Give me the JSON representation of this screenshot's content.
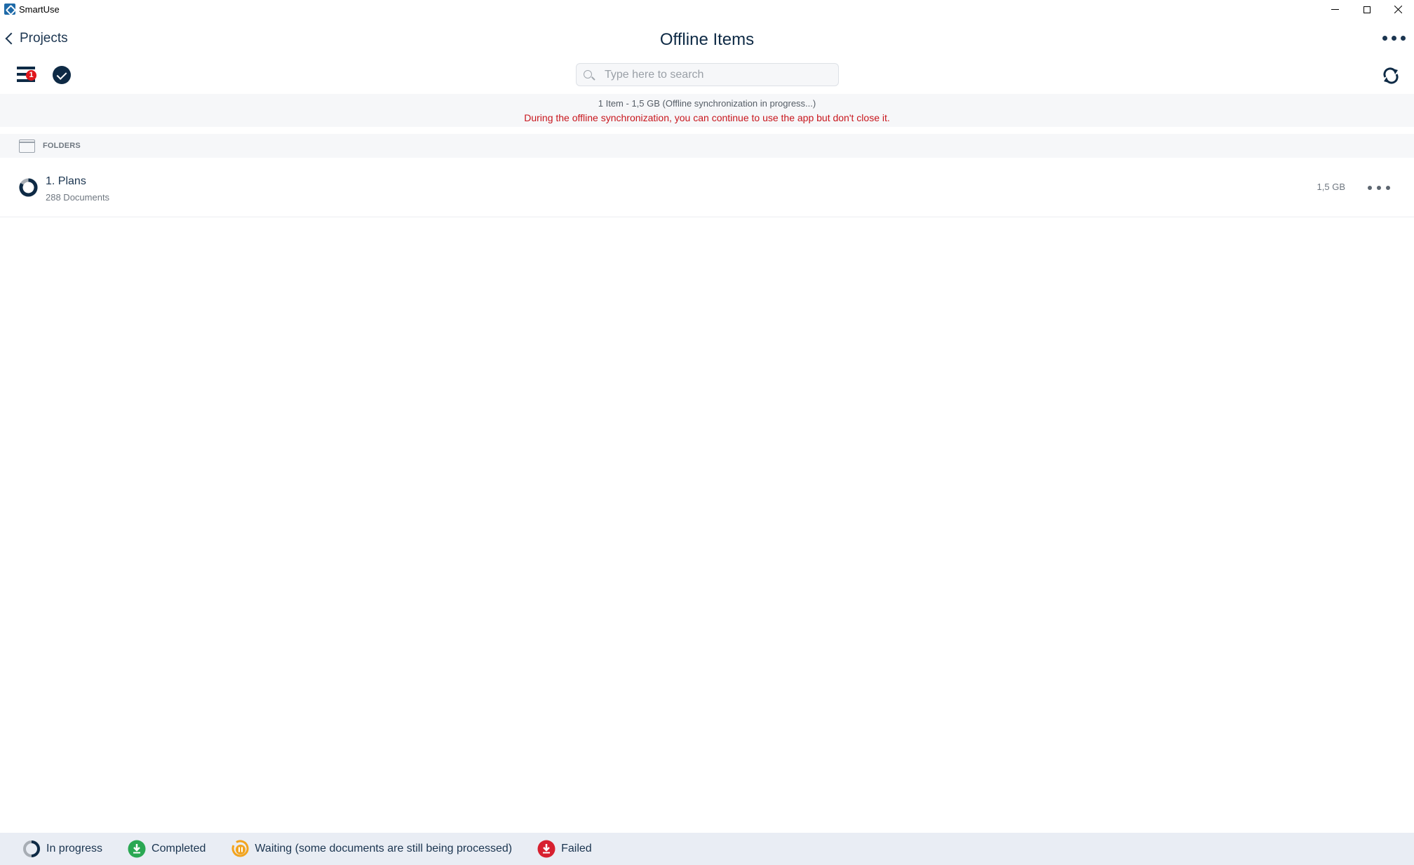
{
  "window": {
    "app_name": "SmartUse",
    "minimize_icon": "minimize-icon",
    "maximize_icon": "maximize-icon",
    "close_icon": "close-icon"
  },
  "header": {
    "back_label": "Projects",
    "title": "Offline Items",
    "badge_count": "1"
  },
  "search": {
    "placeholder": "Type here to search",
    "value": ""
  },
  "banner": {
    "summary": "1 Item - 1,5 GB (Offline synchronization in progress...)",
    "warning": "During the offline synchronization, you can continue to use the app but don't close it.",
    "warning_color": "#c8161d"
  },
  "folders": {
    "section_label": "FOLDERS",
    "items": [
      {
        "title": "1. Plans",
        "subtitle": "288 Documents",
        "size": "1,5 GB",
        "status": "in-progress"
      }
    ]
  },
  "legend": {
    "items": [
      {
        "label": "In progress",
        "icon": "in-progress-icon"
      },
      {
        "label": "Completed",
        "icon": "completed-icon",
        "color": "#2aa853"
      },
      {
        "label": "Waiting (some documents are still being processed)",
        "icon": "waiting-icon",
        "color": "#f2a41f"
      },
      {
        "label": "Failed",
        "icon": "failed-icon",
        "color": "#d7202f"
      }
    ]
  }
}
